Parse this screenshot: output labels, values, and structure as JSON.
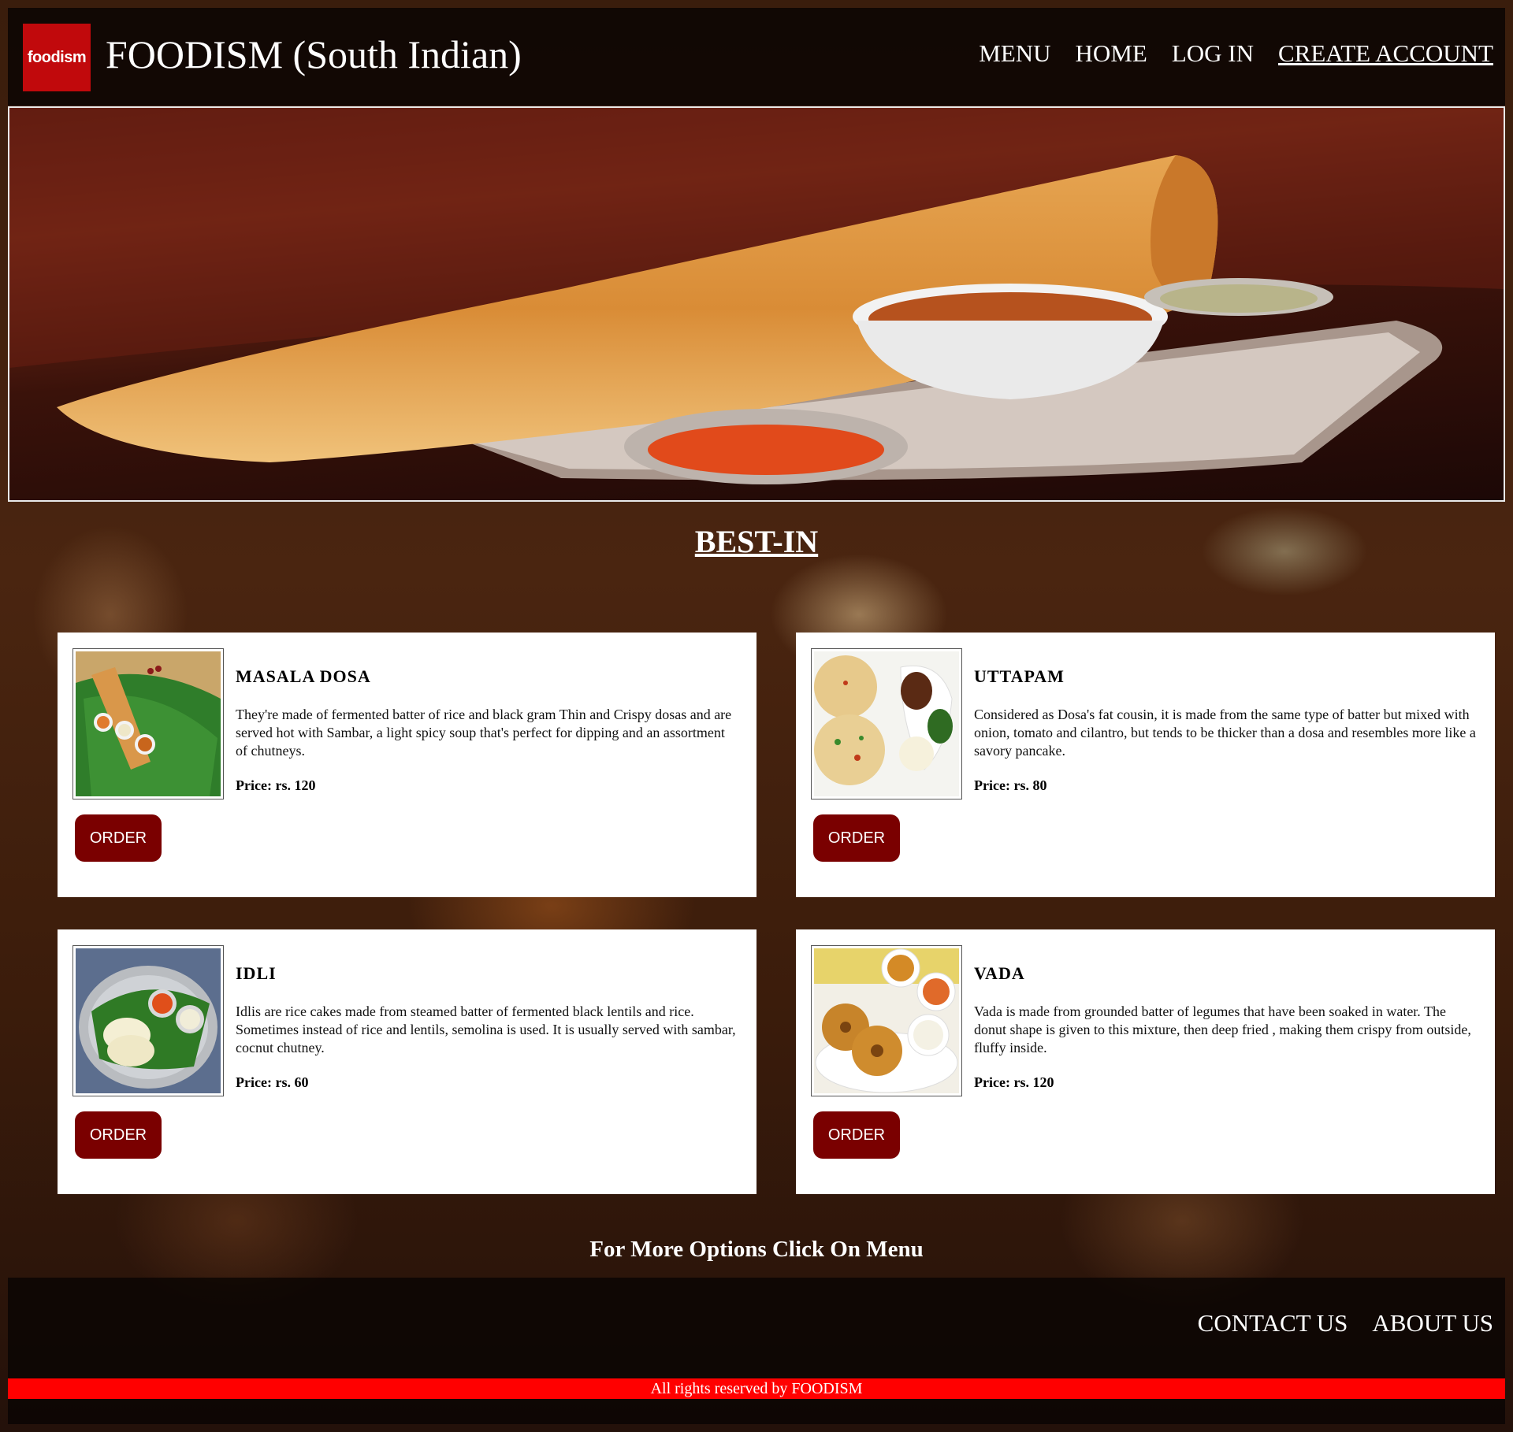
{
  "header": {
    "logo_text": "foodism",
    "title": "FOODISM (South Indian)",
    "nav": [
      "MENU",
      "HOME",
      "LOG IN",
      "CREATE ACCOUNT"
    ]
  },
  "section_title": "BEST-IN",
  "dishes": [
    {
      "name": "MASALA DOSA",
      "description": "They're made of fermented batter of rice and black gram Thin and Crispy dosas and are served hot with Sambar, a light spicy soup that's perfect for dipping and an assortment of chutneys.",
      "price": "Price: rs. 120",
      "order_label": "ORDER"
    },
    {
      "name": "UTTAPAM",
      "description": "Considered as Dosa's fat cousin, it is made from the same type of batter but mixed with onion, tomato and cilantro, but tends to be thicker than a dosa and resembles more like a savory pancake.",
      "price": "Price: rs. 80",
      "order_label": "ORDER"
    },
    {
      "name": "IDLI",
      "description": "Idlis are rice cakes made from steamed batter of fermented black lentils and rice. Sometimes instead of rice and lentils, semolina is used. It is usually served with sambar, cocnut chutney.",
      "price": "Price: rs. 60",
      "order_label": "ORDER"
    },
    {
      "name": "VADA",
      "description": "Vada is made from grounded batter of legumes that have been soaked in water. The donut shape is given to this mixture, then deep fried , making them crispy from outside, fluffy inside.",
      "price": "Price: rs. 120",
      "order_label": "ORDER"
    }
  ],
  "more_options": "For More Options Click On Menu",
  "footer": {
    "links": [
      "CONTACT US",
      "ABOUT US"
    ],
    "copyright": "All rights reserved by FOODISM"
  },
  "colors": {
    "brand_red": "#c1090c",
    "order_button": "#7a0000",
    "copyright_bar": "#ff0000"
  },
  "icons": [
    "dosa-hero-image",
    "masala-dosa-photo",
    "uttapam-photo",
    "idli-photo",
    "vada-photo"
  ]
}
